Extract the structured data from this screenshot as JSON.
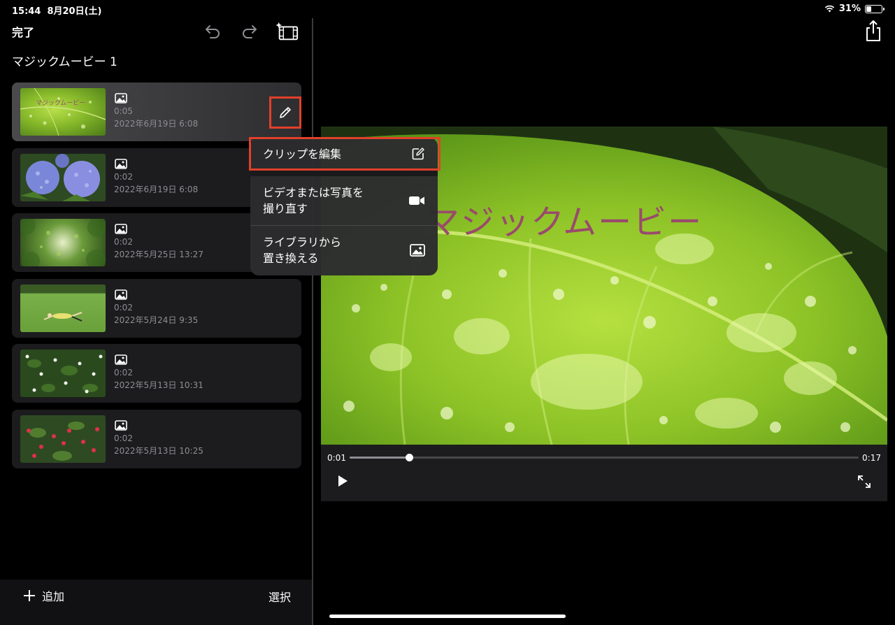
{
  "status": {
    "time": "15:44",
    "date": "8月20日(土)",
    "battery_text": "31%",
    "battery_level": 0.31
  },
  "toolbar": {
    "done_label": "完了"
  },
  "project": {
    "title": "マジックムービー 1"
  },
  "clips": [
    {
      "duration": "0:05",
      "date": "2022年6月19日 6:08"
    },
    {
      "duration": "0:02",
      "date": "2022年6月19日 6:08"
    },
    {
      "duration": "0:02",
      "date": "2022年5月25日 13:27"
    },
    {
      "duration": "0:02",
      "date": "2022年5月24日 9:35"
    },
    {
      "duration": "0:02",
      "date": "2022年5月13日 10:31"
    },
    {
      "duration": "0:02",
      "date": "2022年5月13日 10:25"
    }
  ],
  "menu": {
    "edit_clip": "クリップを編集",
    "retake_line1": "ビデオまたは写真を",
    "retake_line2": "撮り直す",
    "replace_line1": "ライブラリから",
    "replace_line2": "置き換える"
  },
  "player": {
    "video_title": "マジックムービー",
    "current_time": "0:01",
    "total_time": "0:17",
    "progress": 0.117
  },
  "bottom": {
    "add_label": "追加",
    "select_label": "選択"
  },
  "colors": {
    "accent_highlight": "#e2402a",
    "title_text": "#9a4a6c"
  },
  "icons": [
    "wifi-icon",
    "battery-icon",
    "undo-icon",
    "redo-icon",
    "magic-movie-icon",
    "photo-icon",
    "pencil-icon",
    "edit-icon",
    "video-camera-icon",
    "image-icon",
    "share-icon",
    "play-icon",
    "fullscreen-icon",
    "plus-icon"
  ]
}
